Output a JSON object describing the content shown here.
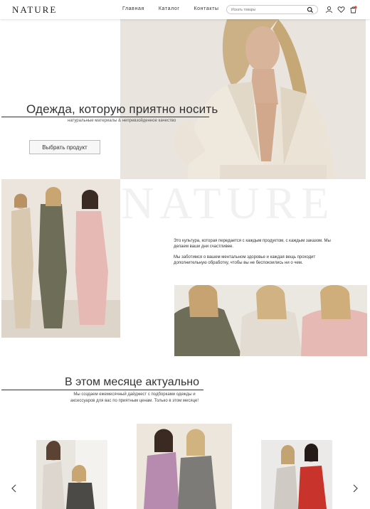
{
  "header": {
    "logo": "NATURE",
    "nav": [
      "Главная",
      "Каталог",
      "Контакты"
    ],
    "search_placeholder": "Искать товары"
  },
  "hero": {
    "title": "Одежда, которую приятно носить",
    "subtitle": "натуральные материалы & непревзойденное качество",
    "button": "Выбрать продукт"
  },
  "about": {
    "watermark": "NATURE",
    "p1": "Это культура, которая передается с каждым продуктом, с каждым заказом. Мы делаем ваши дни счастливее.",
    "p2": "Мы заботимся о вашем ментальном здоровье и каждая вещь проходит дополнительную обработку, чтобы вы не беспокоились ни о чем."
  },
  "month": {
    "title": "В этом месяце актуально",
    "text": "Мы создаем ежемесячный дайджест с подборками одежды и аксессуаров для вас по приятным ценам. Только в этом месяце!"
  },
  "icons": {
    "search": "search-icon",
    "user": "user-icon",
    "heart": "heart-icon",
    "cart": "cart-icon",
    "prev": "chevron-left-icon",
    "next": "chevron-right-icon"
  },
  "colors": {
    "cart_badge": "#e24b3b",
    "suit_pink": "#e7b9b4",
    "suit_olive": "#6e6e58",
    "suit_beige": "#d9c8b0"
  }
}
